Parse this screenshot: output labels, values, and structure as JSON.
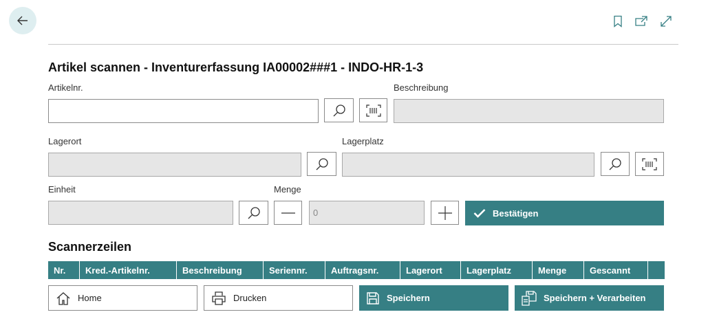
{
  "header": {
    "back_icon": "arrow-left-icon",
    "actions": [
      "bookmark-icon",
      "open-new-window-icon",
      "expand-icon"
    ]
  },
  "page": {
    "title": "Artikel scannen - Inventurerfassung IA00002###1 - INDO-HR-1-3"
  },
  "form": {
    "artikelnr": {
      "label": "Artikelnr.",
      "value": ""
    },
    "beschreibung": {
      "label": "Beschreibung",
      "value": ""
    },
    "lagerort": {
      "label": "Lagerort",
      "value": ""
    },
    "lagerplatz": {
      "label": "Lagerplatz",
      "value": ""
    },
    "einheit": {
      "label": "Einheit",
      "value": ""
    },
    "menge": {
      "label": "Menge",
      "value": "0"
    },
    "confirm_label": "Bestätigen"
  },
  "scanner_lines": {
    "title": "Scannerzeilen",
    "columns": [
      "Nr.",
      "Kred.-Artikelnr.",
      "Beschreibung",
      "Seriennr.",
      "Auftragsnr.",
      "Lagerort",
      "Lagerplatz",
      "Menge",
      "Gescannt",
      ""
    ]
  },
  "footer": {
    "home_label": "Home",
    "print_label": "Drucken",
    "save_label": "Speichern",
    "save_process_label": "Speichern + Verarbeiten"
  },
  "colors": {
    "accent": "#367f84",
    "back_button_bg": "#deeef0",
    "readonly_field_bg": "#e6e6e6"
  }
}
